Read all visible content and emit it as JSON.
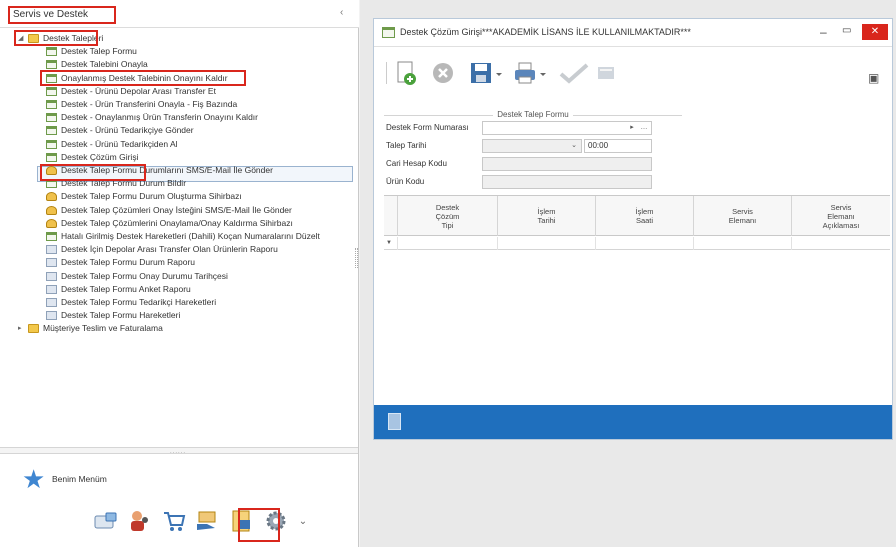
{
  "left_panel": {
    "title": "Servis ve Destek",
    "collapse_glyph": "‹",
    "tree": [
      {
        "level": 0,
        "label": "Destek Talepleri",
        "icon": "folder-icon",
        "expander": "◢"
      },
      {
        "level": 1,
        "label": "Destek Talep Formu",
        "icon": "form-icon"
      },
      {
        "level": 1,
        "label": "Destek Talebini Onayla",
        "icon": "form-icon"
      },
      {
        "level": 1,
        "label": "Onaylanmış Destek Talebinin Onayını Kaldır",
        "icon": "form-icon"
      },
      {
        "level": 1,
        "label": "Destek - Ürünü Depolar Arası Transfer Et",
        "icon": "form-icon"
      },
      {
        "level": 1,
        "label": "Destek - Ürün Transferini Onayla - Fiş Bazında",
        "icon": "form-icon"
      },
      {
        "level": 1,
        "label": "Destek - Onaylanmış Ürün Transferin Onayını Kaldır",
        "icon": "form-icon"
      },
      {
        "level": 1,
        "label": "Destek - Ürünü Tedarikçiye Gönder",
        "icon": "form-icon"
      },
      {
        "level": 1,
        "label": "Destek - Ürünü Tedarikçiden Al",
        "icon": "form-icon"
      },
      {
        "level": 1,
        "label": "Destek Çözüm Girişi",
        "icon": "form-icon"
      },
      {
        "level": 1,
        "label": "Destek Talep Formu Durumlarını SMS/E-Mail İle Gönder",
        "icon": "wizard-icon"
      },
      {
        "level": 1,
        "label": "Destek Talep Formu Durum Bildir",
        "icon": "form-icon"
      },
      {
        "level": 1,
        "label": "Destek Talep Formu Durum Oluşturma Sihirbazı",
        "icon": "wizard-icon"
      },
      {
        "level": 1,
        "label": "Destek Talep Çözümleri Onay İsteğini SMS/E-Mail İle Gönder",
        "icon": "wizard-icon"
      },
      {
        "level": 1,
        "label": "Destek Talep Çözümlerini Onaylama/Onay Kaldırma Sihirbazı",
        "icon": "wizard-icon"
      },
      {
        "level": 1,
        "label": "Hatalı Girilmiş Destek Hareketleri (Dahili) Koçan Numaralarını Düzelt",
        "icon": "form-icon"
      },
      {
        "level": 1,
        "label": "Destek İçin Depolar Arası Transfer Olan Ürünlerin Raporu",
        "icon": "report-icon"
      },
      {
        "level": 1,
        "label": "Destek Talep Formu Durum Raporu",
        "icon": "report-icon"
      },
      {
        "level": 1,
        "label": "Destek Talep Formu Onay Durumu Tarihçesi",
        "icon": "report-icon"
      },
      {
        "level": 1,
        "label": "Destek Talep Formu Anket Raporu",
        "icon": "report-icon"
      },
      {
        "level": 1,
        "label": "Destek Talep Formu Tedarikçi Hareketleri",
        "icon": "report-icon"
      },
      {
        "level": 1,
        "label": "Destek Talep Formu Hareketleri",
        "icon": "report-icon"
      },
      {
        "level": 0,
        "label": "Müşteriye Teslim ve Faturalama",
        "icon": "folder-icon",
        "expander": "▸"
      }
    ],
    "divider_dots": "......",
    "favorites_label": "Benim Menüm",
    "bottom_icons": [
      "card-icon",
      "users-icon",
      "cart-icon",
      "hand-icon",
      "document-icon",
      "gear-icon"
    ],
    "more_glyph": "⌄"
  },
  "window": {
    "title": "Destek Çözüm Girişi***AKADEMİK LİSANS İLE KULLANILMAKTADIR***",
    "min_glyph": "–",
    "max_glyph": "▭",
    "close_glyph": "✕",
    "toolbar": [
      "new-icon",
      "cancel-icon",
      "save-icon",
      "print-icon",
      "approve-icon",
      "grid-icon"
    ],
    "group_title": "Destek Talep Formu",
    "fields": [
      {
        "label": "Destek Form Numarası",
        "value": "",
        "disabled": false
      },
      {
        "label": "Talep Tarihi",
        "value": "",
        "time": "00:00",
        "disabled": true
      },
      {
        "label": "Cari Hesap Kodu",
        "value": "",
        "disabled": true
      },
      {
        "label": "Ürün Kodu",
        "value": "",
        "disabled": true
      }
    ],
    "grid_columns": [
      "Destek\nÇözüm\nTipi",
      "İşlem\nTarihi",
      "İşlem\nSaati",
      "Servis\nElemanı",
      "Servis\nElemanı\nAçıklaması"
    ],
    "new_row_marker": "▼"
  },
  "colors": {
    "highlight": "#d9261c",
    "statusbar": "#1f6fbd",
    "close_button": "#d9261c"
  }
}
